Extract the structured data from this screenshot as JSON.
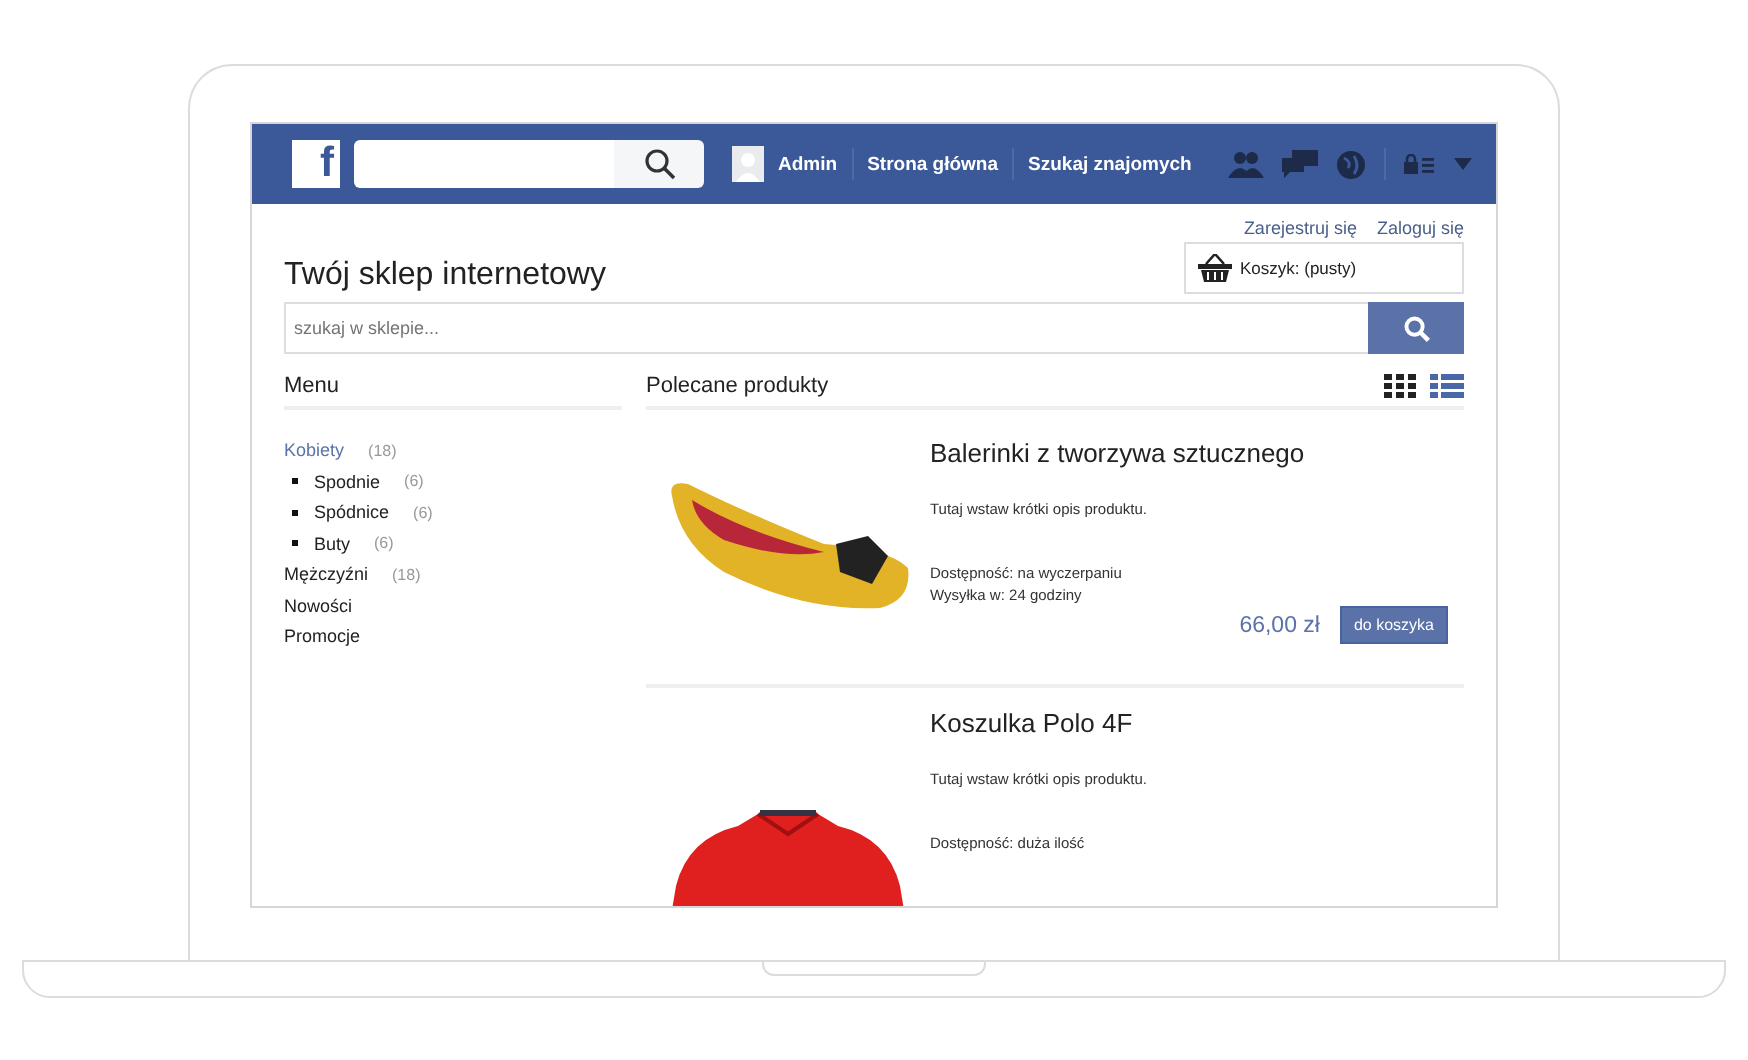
{
  "topbar": {
    "logo": "f",
    "user": "Admin",
    "links": [
      "Strona główna",
      "Szukaj znajomych"
    ]
  },
  "auth_links": [
    "Zarejestruj się",
    "Zaloguj się"
  ],
  "shop_title": "Twój sklep internetowy",
  "cart": {
    "label": "Koszyk: (pusty)"
  },
  "search": {
    "placeholder": "szukaj w sklepie..."
  },
  "menu": {
    "title": "Menu",
    "items": [
      {
        "label": "Kobiety",
        "count": "(18)",
        "selected": true,
        "children": [
          {
            "label": "Spodnie",
            "count": "(6)",
            "selected": false
          },
          {
            "label": "Spódnice",
            "count": "(6)",
            "selected": false
          },
          {
            "label": "Buty",
            "count": "(6)",
            "selected": false
          }
        ]
      },
      {
        "label": "Mężczyźni",
        "count": "(18)",
        "selected": false
      },
      {
        "label": "Nowości",
        "selected": false
      },
      {
        "label": "Promocje",
        "selected": false
      }
    ]
  },
  "products_title": "Polecane produkty",
  "view_modes": [
    {
      "kind": "grid",
      "selected": false
    },
    {
      "kind": "list",
      "selected": true
    }
  ],
  "products": [
    {
      "kind": "shoe",
      "name": "Balerinki z tworzywa sztucznego",
      "description": "Tutaj wstaw krótki opis produktu.",
      "availability": "Dostępność: na wyczerpaniu",
      "shipping": "Wysyłka w: 24 godziny",
      "price": "66,00 zł",
      "button": "do koszyka"
    },
    {
      "kind": "shirt",
      "name": "Koszulka Polo 4F",
      "description": "Tutaj wstaw krótki opis produktu.",
      "availability": "Dostępność: duża ilość"
    }
  ]
}
